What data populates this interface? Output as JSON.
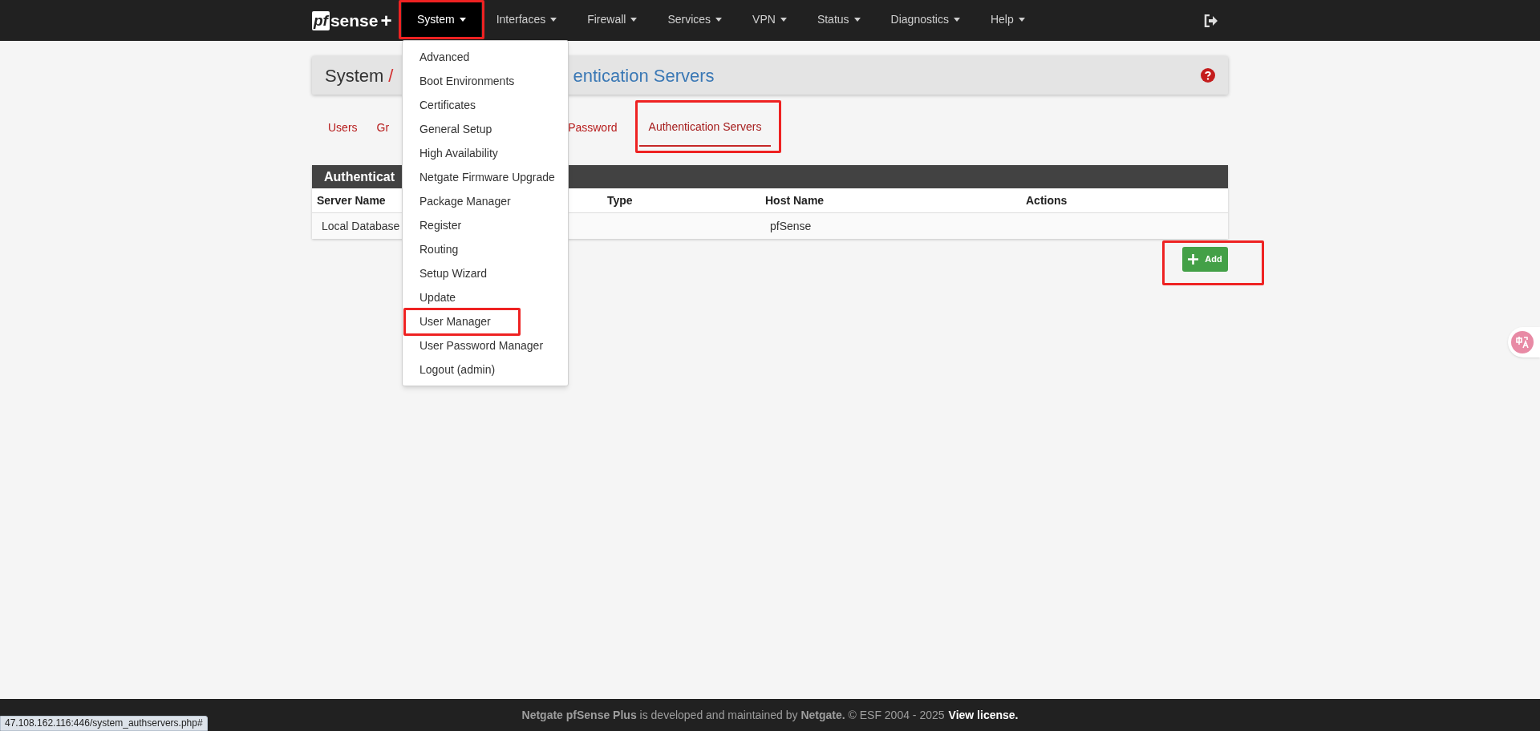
{
  "navbar": {
    "logo": {
      "mark": "pf",
      "name": "sense",
      "suffix": "+"
    },
    "menus": [
      {
        "label": "System",
        "selected": true,
        "highlighted": true
      },
      {
        "label": "Interfaces",
        "selected": false,
        "highlighted": false
      },
      {
        "label": "Firewall",
        "selected": false,
        "highlighted": false
      },
      {
        "label": "Services",
        "selected": false,
        "highlighted": false
      },
      {
        "label": "VPN",
        "selected": false,
        "highlighted": false
      },
      {
        "label": "Status",
        "selected": false,
        "highlighted": false
      },
      {
        "label": "Diagnostics",
        "selected": false,
        "highlighted": false
      },
      {
        "label": "Help",
        "selected": false,
        "highlighted": false
      }
    ],
    "dropdown": [
      {
        "label": "Advanced",
        "highlighted": false
      },
      {
        "label": "Boot Environments",
        "highlighted": false
      },
      {
        "label": "Certificates",
        "highlighted": false
      },
      {
        "label": "General Setup",
        "highlighted": false
      },
      {
        "label": "High Availability",
        "highlighted": false
      },
      {
        "label": "Netgate Firmware Upgrade",
        "highlighted": false
      },
      {
        "label": "Package Manager",
        "highlighted": false
      },
      {
        "label": "Register",
        "highlighted": false
      },
      {
        "label": "Routing",
        "highlighted": false
      },
      {
        "label": "Setup Wizard",
        "highlighted": false
      },
      {
        "label": "Update",
        "highlighted": false
      },
      {
        "label": "User Manager",
        "highlighted": true
      },
      {
        "label": "User Password Manager",
        "highlighted": false
      },
      {
        "label": "Logout (admin)",
        "highlighted": false
      }
    ]
  },
  "breadcrumb": {
    "root": "System",
    "separator": "/",
    "current": "entication Servers"
  },
  "tabs": [
    {
      "label": "Users",
      "selected": false,
      "highlighted": false
    },
    {
      "label": "Gr",
      "selected": false,
      "highlighted": false
    },
    {
      "label": "Password",
      "selected": false,
      "highlighted": false
    },
    {
      "label": "Authentication Servers",
      "selected": true,
      "highlighted": true
    }
  ],
  "panel": {
    "title": "Authenticat",
    "columns": [
      "Server Name",
      "Type",
      "Host Name",
      "Actions"
    ],
    "rows": [
      [
        "Local Database",
        "",
        "pfSense",
        ""
      ]
    ]
  },
  "add_button": {
    "label": "Add",
    "highlighted": true
  },
  "footer": {
    "text": "**Netgate pfSense Plus** is developed and maintained by **Netgate.** © ESF 2004 - 2025",
    "link": "View license."
  },
  "status_url": "47.108.162.116:446/system_authservers.php#"
}
